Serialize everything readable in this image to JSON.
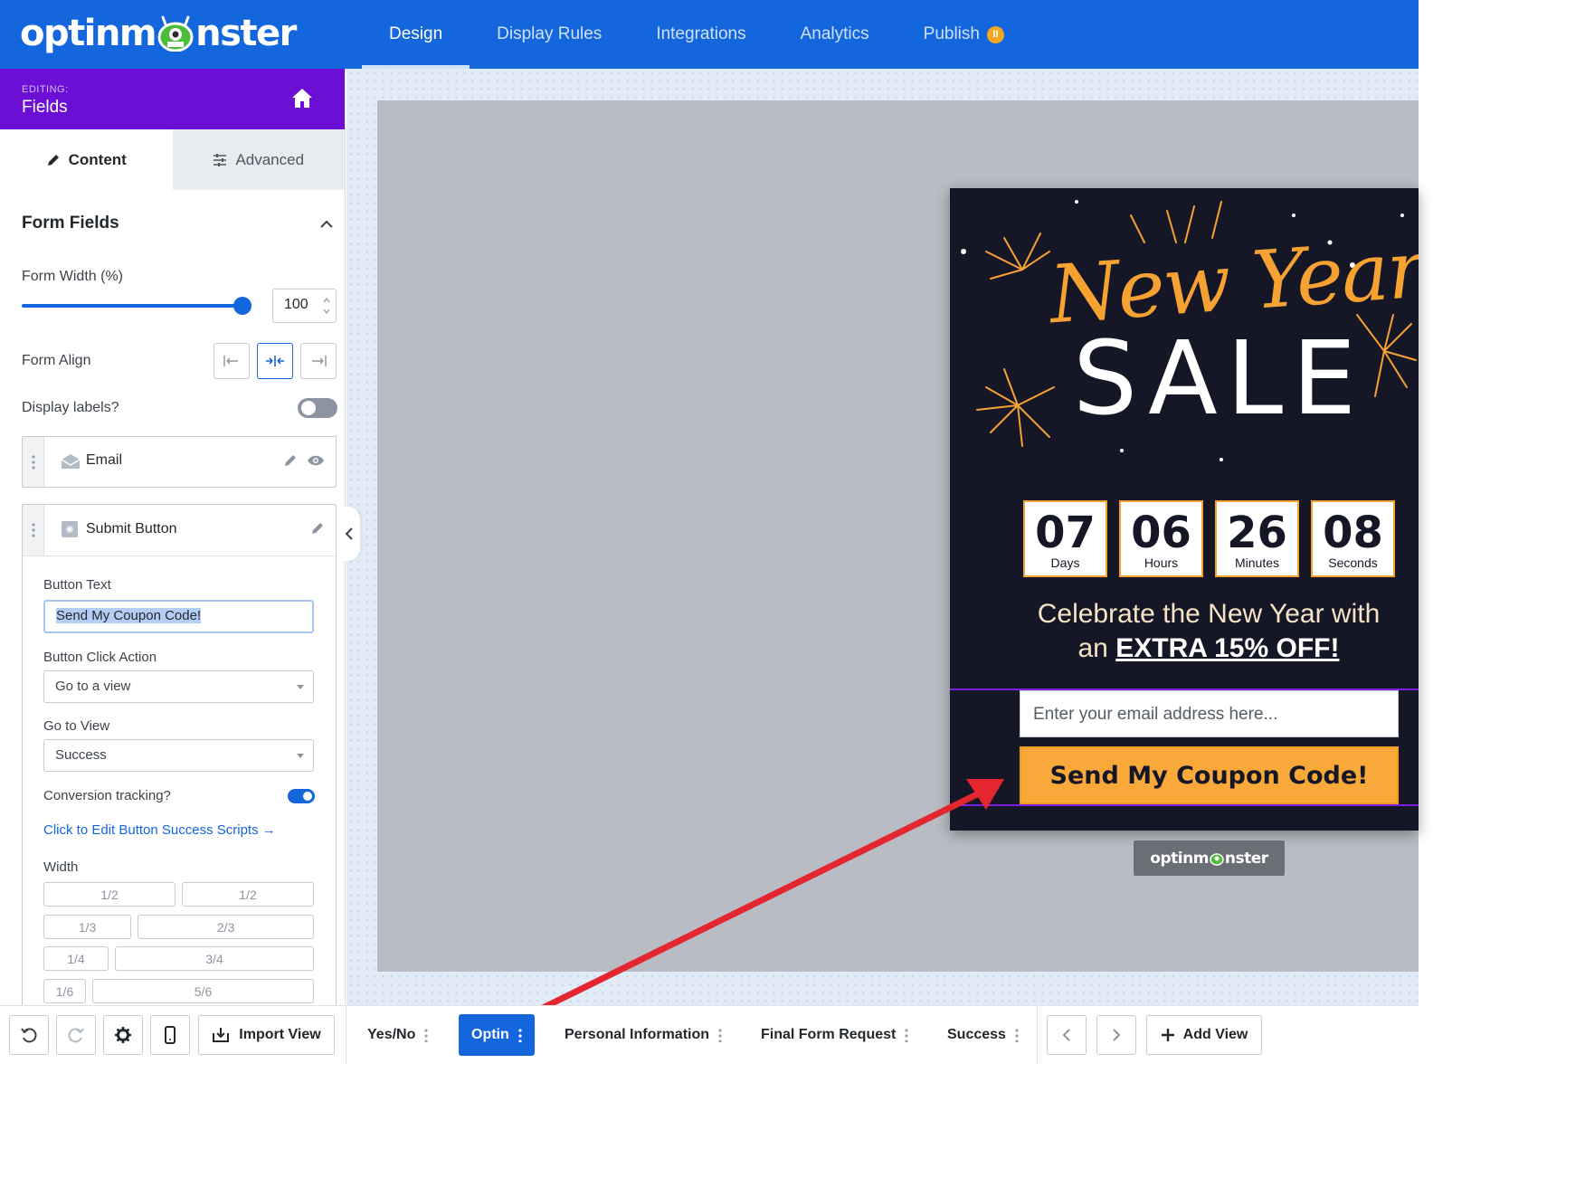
{
  "topbar": {
    "logo_left": "optinm",
    "logo_right": "nster",
    "tabs": [
      {
        "label": "Design",
        "active": true
      },
      {
        "label": "Display Rules",
        "active": false
      },
      {
        "label": "Integrations",
        "active": false
      },
      {
        "label": "Analytics",
        "active": false
      },
      {
        "label": "Publish",
        "active": false
      }
    ],
    "publish_badge": "II"
  },
  "sidebar": {
    "editing_label": "EDITING:",
    "editing_title": "Fields",
    "tabs": {
      "content": "Content",
      "advanced": "Advanced"
    },
    "section_title": "Form Fields",
    "form_width_label": "Form Width (%)",
    "form_width_value": "100",
    "form_width_slider_fraction": 1.0,
    "form_align_label": "Form Align",
    "form_align_selected": "center",
    "display_labels_label": "Display labels?",
    "display_labels_on": false,
    "fields": [
      {
        "name": "Email",
        "icon": "envelope-icon"
      },
      {
        "name": "Submit Button",
        "icon": "cursor-click-icon"
      }
    ],
    "button_text_label": "Button Text",
    "button_text_value": "Send My Coupon Code!",
    "click_action_label": "Button Click Action",
    "click_action_value": "Go to a view",
    "go_to_view_label": "Go to View",
    "go_to_view_value": "Success",
    "conversion_label": "Conversion tracking?",
    "conversion_on": true,
    "success_scripts_link": "Click to Edit Button Success Scripts →",
    "width_label": "Width",
    "width_options": [
      "1/2",
      "1/2",
      "1/3",
      "2/3",
      "1/4",
      "3/4",
      "1/6",
      "5/6"
    ]
  },
  "popup": {
    "script_title": "New Year",
    "sale_title": "SALE",
    "countdown": [
      {
        "value": "07",
        "unit": "Days"
      },
      {
        "value": "06",
        "unit": "Hours"
      },
      {
        "value": "26",
        "unit": "Minutes"
      },
      {
        "value": "08",
        "unit": "Seconds"
      }
    ],
    "headline_line1": "Celebrate the New Year with",
    "headline_line2_prefix": "an ",
    "headline_line2_emphasis": "EXTRA 15% OFF!",
    "email_placeholder": "Enter your email address here...",
    "cta_label": "Send My Coupon Code!",
    "brand_badge_left": "optinm",
    "brand_badge_right": "nster"
  },
  "bottombar": {
    "import_label": "Import View",
    "views": [
      {
        "label": "Yes/No",
        "active": false
      },
      {
        "label": "Optin",
        "active": true
      },
      {
        "label": "Personal Information",
        "active": false
      },
      {
        "label": "Final Form Request",
        "active": false
      },
      {
        "label": "Success",
        "active": false
      }
    ],
    "add_view_label": "Add View"
  },
  "colors": {
    "brand_blue": "#1466dc",
    "editing_purple": "#6b0fd5",
    "popup_bg": "#161726",
    "accent_orange": "#f9a83a",
    "annotation_red": "#e3262f"
  }
}
